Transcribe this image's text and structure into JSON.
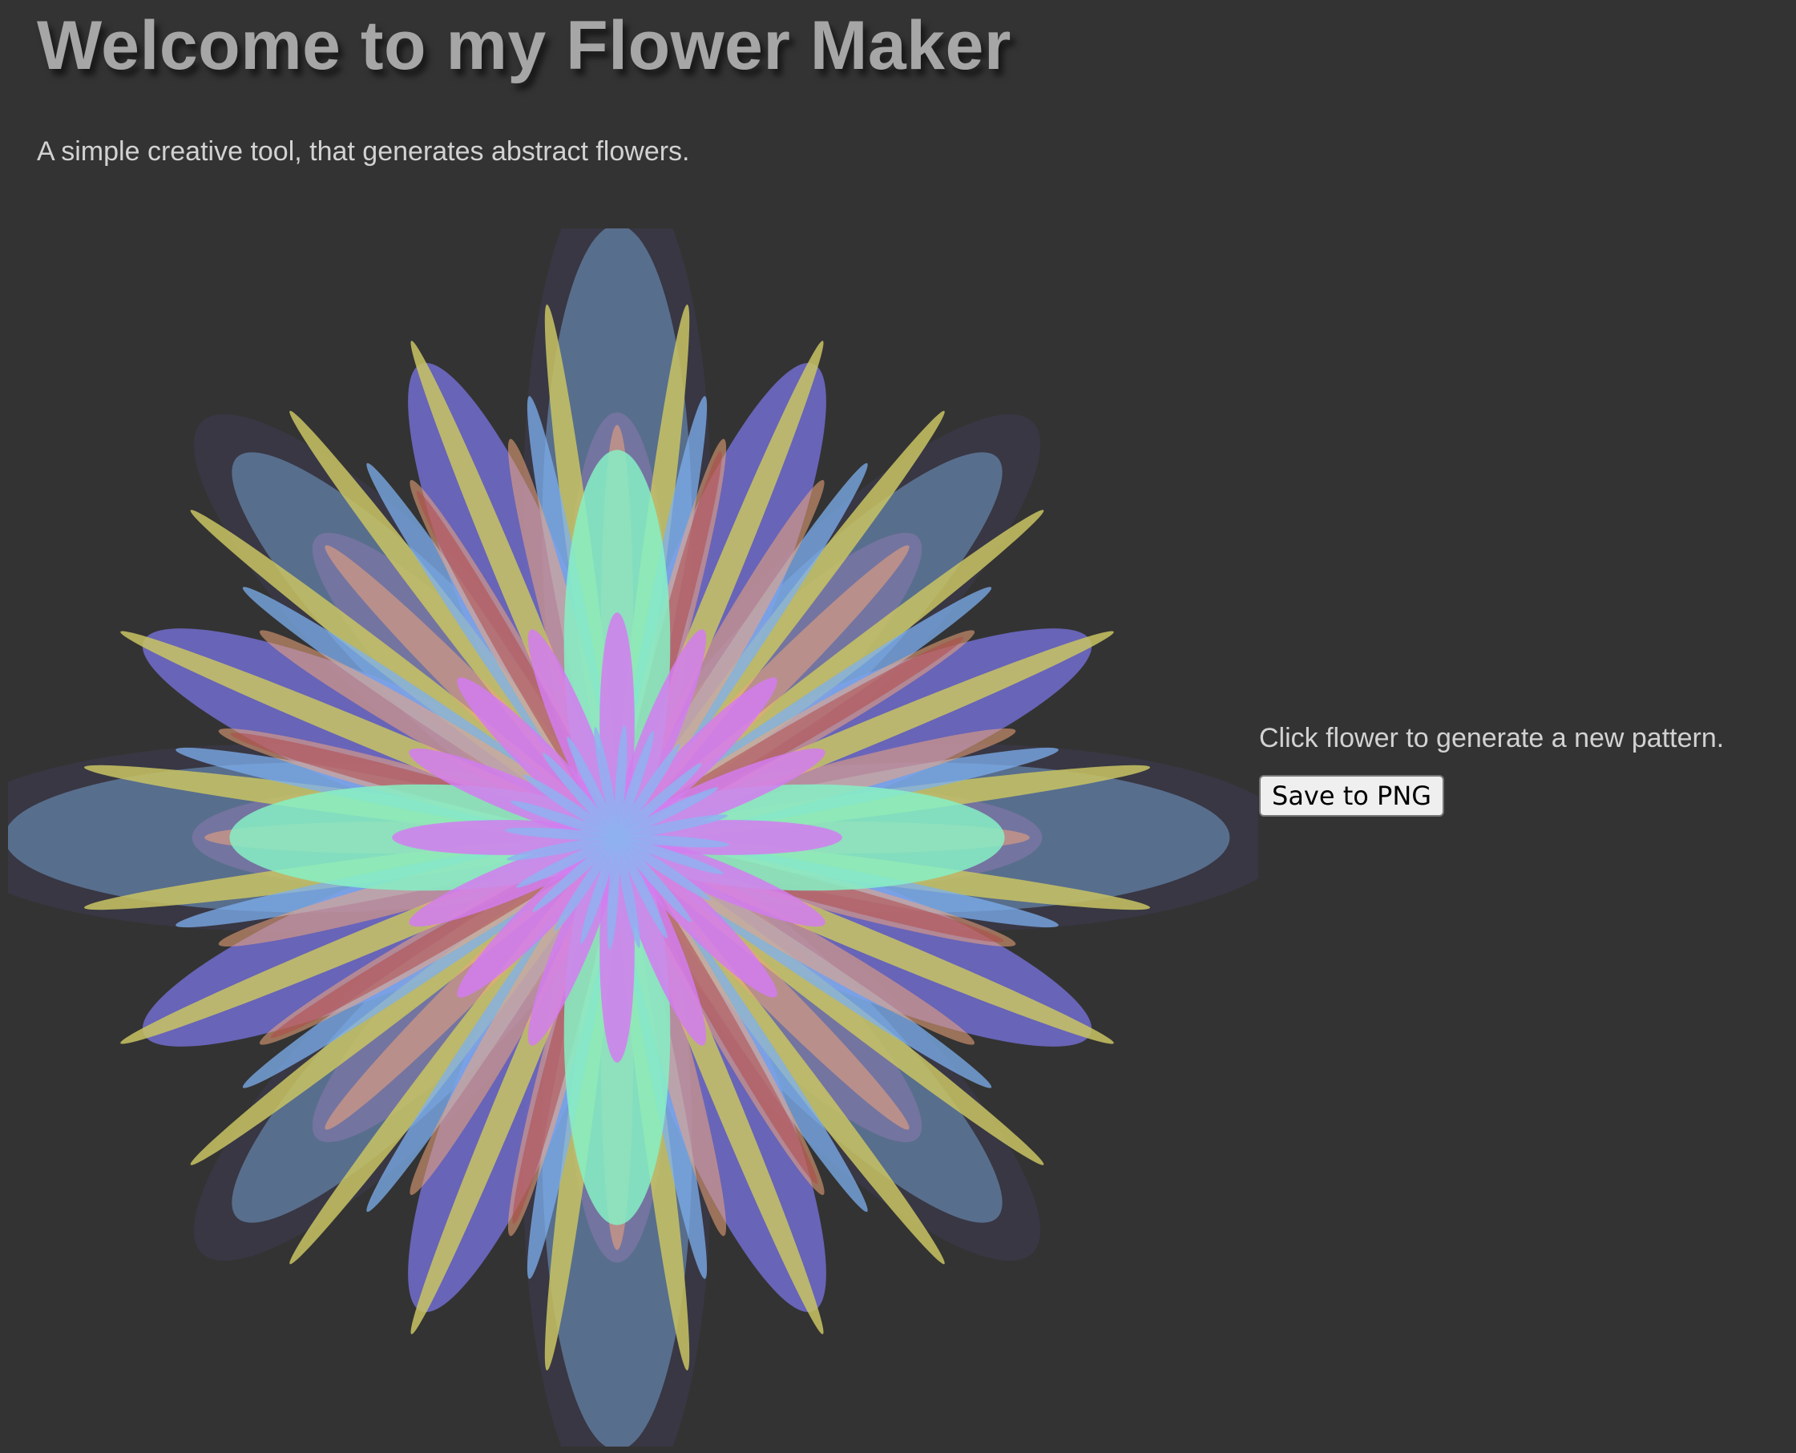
{
  "header": {
    "title": "Welcome to my Flower Maker",
    "subtitle": "A simple creative tool, that generates abstract flowers."
  },
  "controls": {
    "hint": "Click flower to generate a new pattern.",
    "save_label": "Save to PNG"
  },
  "flower": {
    "layers": [
      {
        "name": "outer-halo",
        "count": 4,
        "rx": 0.15,
        "ry": 0.54,
        "color": "#3a3847",
        "opacity": 0.85,
        "offset_deg": 0
      },
      {
        "name": "outer-halo-diag",
        "count": 4,
        "rx": 0.13,
        "ry": 0.47,
        "color": "#3a3847",
        "opacity": 0.85,
        "offset_deg": 45
      },
      {
        "name": "slate-petals",
        "count": 4,
        "rx": 0.12,
        "ry": 0.49,
        "color": "#5a7191",
        "opacity": 0.95,
        "offset_deg": 0
      },
      {
        "name": "slate-petals-diag",
        "count": 4,
        "rx": 0.1,
        "ry": 0.43,
        "color": "#5a7191",
        "opacity": 0.95,
        "offset_deg": 45
      },
      {
        "name": "violet-petals",
        "count": 8,
        "rx": 0.09,
        "ry": 0.41,
        "color": "#7570d8",
        "opacity": 0.8,
        "offset_deg": 22.5
      },
      {
        "name": "mauve-inner",
        "count": 8,
        "rx": 0.08,
        "ry": 0.34,
        "color": "#8c7ab0",
        "opacity": 0.55,
        "offset_deg": 0
      },
      {
        "name": "olive-spikes",
        "count": 24,
        "rx": 0.02,
        "ry": 0.43,
        "color": "#c9c463",
        "opacity": 0.85,
        "offset_deg": 7.5
      },
      {
        "name": "sky-blades",
        "count": 16,
        "rx": 0.022,
        "ry": 0.36,
        "color": "#7eb0ef",
        "opacity": 0.75,
        "offset_deg": 11.25
      },
      {
        "name": "peach-blades",
        "count": 24,
        "rx": 0.026,
        "ry": 0.33,
        "color": "#f0a57a",
        "opacity": 0.55,
        "offset_deg": 0
      },
      {
        "name": "rust-blades",
        "count": 8,
        "rx": 0.018,
        "ry": 0.32,
        "color": "#b04a4a",
        "opacity": 0.55,
        "offset_deg": 15
      },
      {
        "name": "mint-petals",
        "count": 4,
        "rx": 0.085,
        "ry": 0.31,
        "color": "#86f0c4",
        "opacity": 0.85,
        "offset_deg": 0
      },
      {
        "name": "pink-petals",
        "count": 16,
        "rx": 0.028,
        "ry": 0.18,
        "color": "#d27df0",
        "opacity": 0.85,
        "offset_deg": 0
      },
      {
        "name": "center-blades",
        "count": 24,
        "rx": 0.008,
        "ry": 0.09,
        "color": "#8fb2f0",
        "opacity": 0.85,
        "offset_deg": 3.75
      }
    ]
  }
}
